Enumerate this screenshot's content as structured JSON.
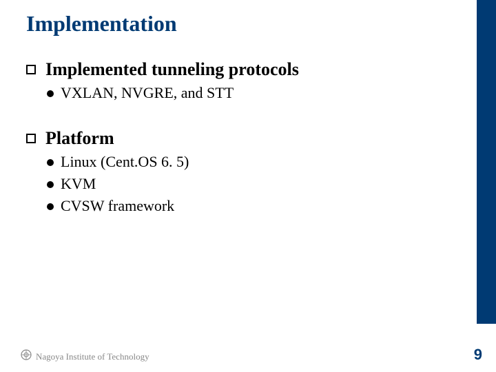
{
  "title": "Implementation",
  "l1a": "Implemented tunneling protocols",
  "l1a_sub1": "VXLAN, NVGRE, and STT",
  "l1b": "Platform",
  "l1b_sub1": "Linux (Cent.OS 6. 5)",
  "l1b_sub2": "KVM",
  "l1b_sub3": "CVSW framework",
  "footer_text": "Nagoya Institute of Technology",
  "page_number": "9"
}
